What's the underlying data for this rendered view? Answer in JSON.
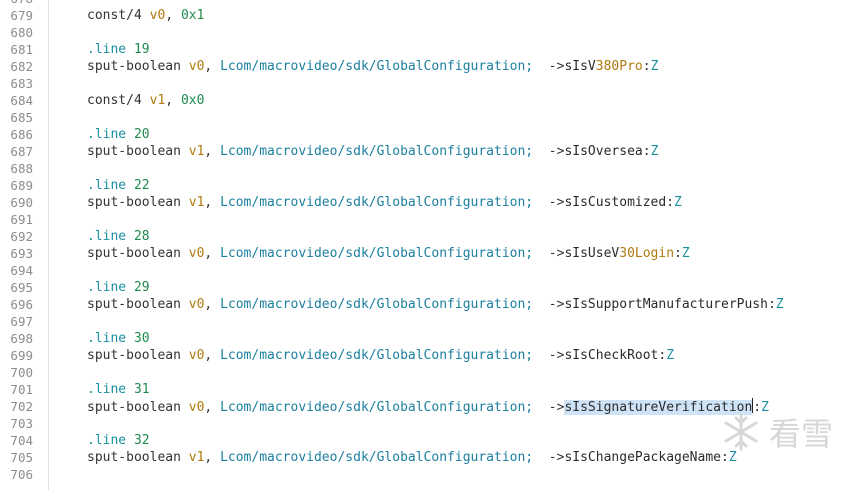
{
  "syntax": {
    "kw": "sput-boolean",
    "const": "const/4",
    "directive": ".line",
    "class_path": "Lcom/macrovideo/sdk/GlobalConfiguration;",
    "arrow": "->",
    "type": "Z",
    "colon": ":",
    "comma": ","
  },
  "lines": [
    {
      "n": "678"
    },
    {
      "n": "679",
      "kind": "const",
      "reg": "v0",
      "val": "0x1"
    },
    {
      "n": "680"
    },
    {
      "n": "681",
      "kind": "line",
      "num": "19"
    },
    {
      "n": "682",
      "kind": "sput",
      "reg": "v0",
      "field_pre": "sIsV",
      "field_num": "380Pro",
      "field_post": ""
    },
    {
      "n": "683"
    },
    {
      "n": "684",
      "kind": "const",
      "reg": "v1",
      "val": "0x0"
    },
    {
      "n": "685"
    },
    {
      "n": "686",
      "kind": "line",
      "num": "20"
    },
    {
      "n": "687",
      "kind": "sput",
      "reg": "v1",
      "field_pre": "sIsOversea",
      "field_num": "",
      "field_post": ""
    },
    {
      "n": "688"
    },
    {
      "n": "689",
      "kind": "line",
      "num": "22"
    },
    {
      "n": "690",
      "kind": "sput",
      "reg": "v1",
      "field_pre": "sIsCustomized",
      "field_num": "",
      "field_post": ""
    },
    {
      "n": "691"
    },
    {
      "n": "692",
      "kind": "line",
      "num": "28"
    },
    {
      "n": "693",
      "kind": "sput",
      "reg": "v0",
      "field_pre": "sIsUseV",
      "field_num": "30Login",
      "field_post": ""
    },
    {
      "n": "694"
    },
    {
      "n": "695",
      "kind": "line",
      "num": "29"
    },
    {
      "n": "696",
      "kind": "sput",
      "reg": "v0",
      "field_pre": "sIsSupportManufacturerPush",
      "field_num": "",
      "field_post": ""
    },
    {
      "n": "697"
    },
    {
      "n": "698",
      "kind": "line",
      "num": "30"
    },
    {
      "n": "699",
      "kind": "sput",
      "reg": "v0",
      "field_pre": "sIsCheckRoot",
      "field_num": "",
      "field_post": ""
    },
    {
      "n": "700"
    },
    {
      "n": "701",
      "kind": "line",
      "num": "31"
    },
    {
      "n": "702",
      "kind": "sput",
      "reg": "v0",
      "field_pre": "sIsSignatureVerification",
      "field_num": "",
      "field_post": "",
      "selected": true
    },
    {
      "n": "703"
    },
    {
      "n": "704",
      "kind": "line",
      "num": "32"
    },
    {
      "n": "705",
      "kind": "sput",
      "reg": "v1",
      "field_pre": "sIsChangePackageName",
      "field_num": "",
      "field_post": ""
    },
    {
      "n": "706"
    }
  ],
  "watermark": {
    "text": "看雪",
    "icon": "snowflake-logo-icon"
  },
  "colors": {
    "register": "#b07a0e",
    "number": "#1f8a4d",
    "directive": "#1b8fa0",
    "selection": "#cfe3f7"
  }
}
